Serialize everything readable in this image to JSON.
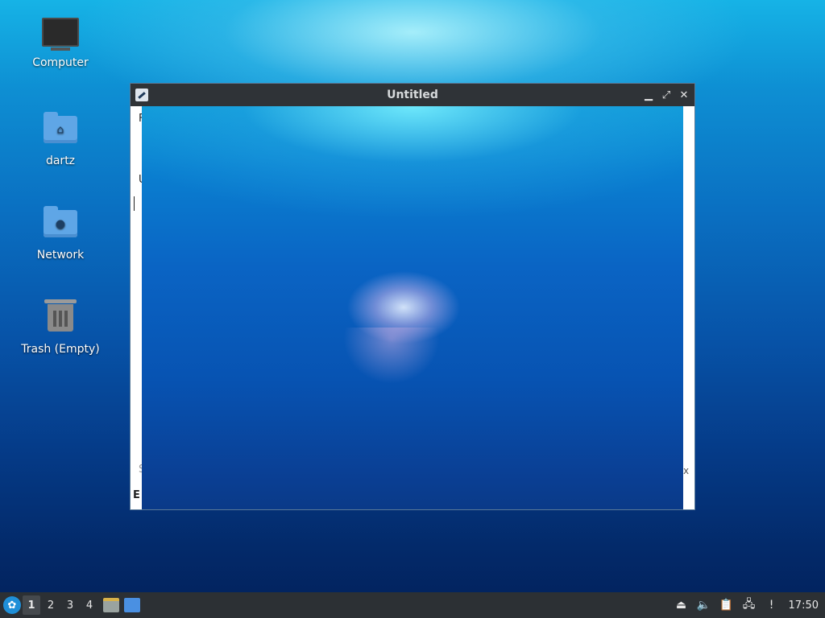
{
  "desktop": {
    "icons": [
      {
        "label": "Computer",
        "icon": "computer-icon"
      },
      {
        "label": "dartz",
        "icon": "home-folder-icon"
      },
      {
        "label": "Network",
        "icon": "network-folder-icon"
      },
      {
        "label": "Trash (Empty)",
        "icon": "trash-icon"
      }
    ]
  },
  "window": {
    "title": "Untitled",
    "fragments": {
      "menu_letter": "F",
      "tab_letter": "U",
      "search_letter": "S",
      "close_letter": "x",
      "status_letter": "E"
    },
    "controls": {
      "minimize": "minimize-icon",
      "maximize": "maximize-icon",
      "close": "close-icon"
    }
  },
  "panel": {
    "workspaces": [
      "1",
      "2",
      "3",
      "4"
    ],
    "active_workspace": "1",
    "tray": {
      "clock": "17:50"
    }
  }
}
